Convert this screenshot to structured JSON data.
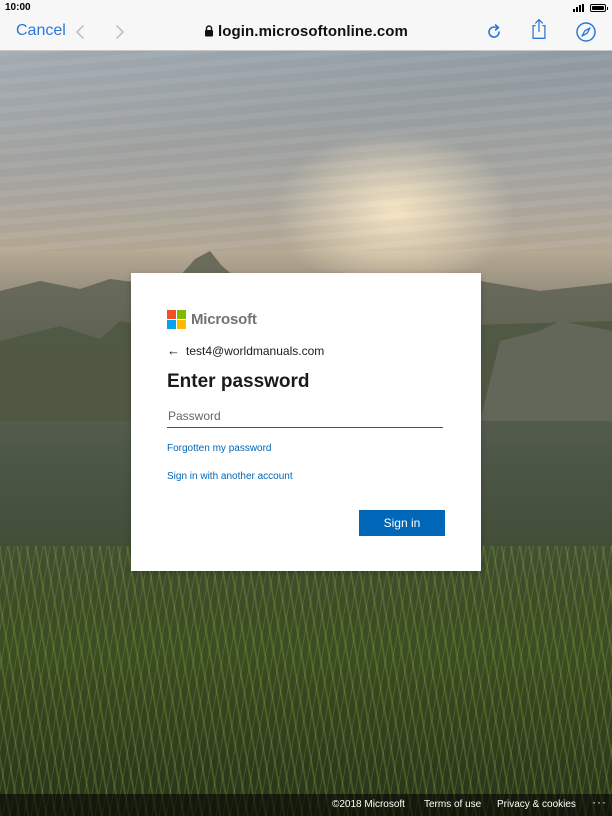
{
  "status_bar": {
    "time": "10:00"
  },
  "browser": {
    "cancel_label": "Cancel",
    "url": "login.microsoftonline.com",
    "icons": [
      "back-arrow-icon",
      "forward-arrow-icon",
      "lock-icon",
      "reload-icon",
      "share-icon",
      "compass-icon"
    ],
    "accent_color": "#2b78d7"
  },
  "signin": {
    "brand": "Microsoft",
    "account": "test4@worldmanuals.com",
    "title": "Enter password",
    "password_placeholder": "Password",
    "password_value": "",
    "forgot_link": "Forgotten my password",
    "other_account_link": "Sign in with another account",
    "submit_label": "Sign in",
    "brand_colors": [
      "#f25022",
      "#7fba00",
      "#00a4ef",
      "#ffb900"
    ],
    "primary_color": "#0067b8"
  },
  "footer": {
    "copyright": "©2018 Microsoft",
    "terms": "Terms of use",
    "privacy": "Privacy & cookies",
    "more": "···"
  }
}
